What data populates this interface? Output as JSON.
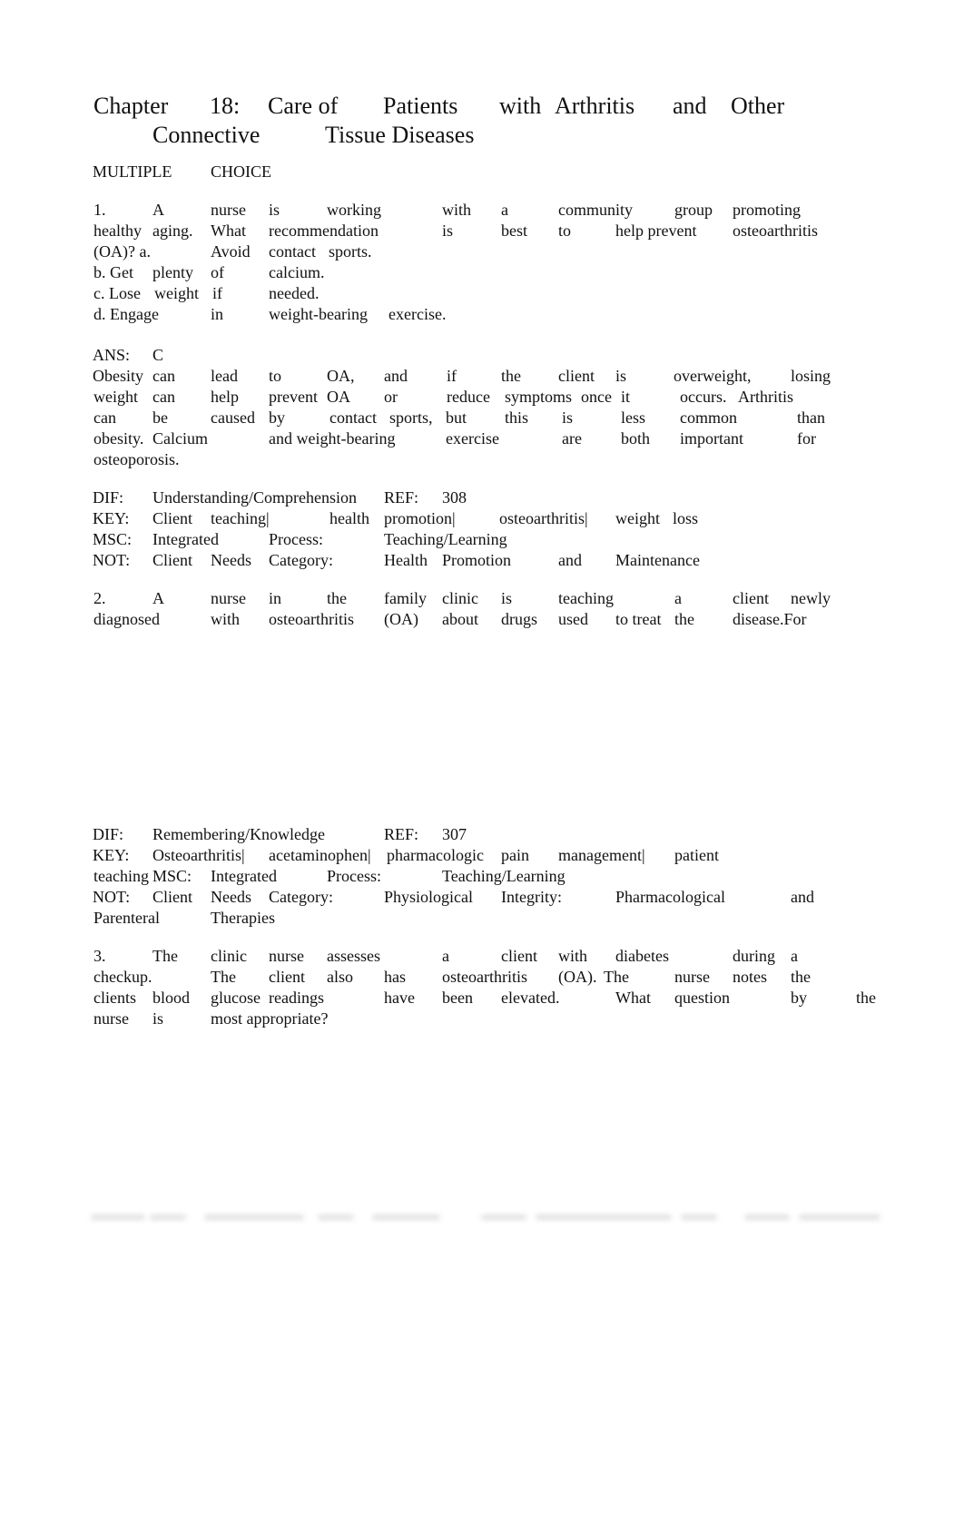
{
  "document": {
    "title_line1": [
      "Chapter",
      "18:",
      "Care of",
      "Patients",
      "with",
      "Arthritis",
      "and",
      "Other"
    ],
    "title_line2": [
      "Connective",
      "Tissue Diseases"
    ],
    "section_heading": [
      "MULTIPLE",
      "CHOICE"
    ],
    "q1": {
      "lines": [
        [
          "1.",
          "A",
          "nurse",
          "is",
          "working",
          "with",
          "a",
          "community",
          "group",
          "promoting"
        ],
        [
          "healthy",
          "aging.",
          "What",
          "recommendation",
          "is",
          "best",
          "to",
          "help prevent",
          "osteoarthritis"
        ],
        [
          "(OA)? a.",
          "Avoid",
          "contact",
          "sports."
        ],
        [
          "b. Get",
          "plenty",
          "of",
          "calcium."
        ],
        [
          "c. Lose",
          "weight",
          "if",
          "needed."
        ],
        [
          "d. Engage",
          "in",
          "weight-bearing",
          "exercise."
        ]
      ],
      "answer": [
        "ANS:",
        "C"
      ],
      "rationale_lines": [
        [
          "Obesity",
          "can",
          "lead",
          "to",
          "OA,",
          "and",
          "if",
          "the",
          "client",
          "is",
          "overweight,",
          "losing"
        ],
        [
          "weight",
          "can",
          "help",
          "prevent",
          "OA",
          "or",
          "reduce",
          "symptoms",
          "once",
          "it",
          "occurs.",
          "Arthritis"
        ],
        [
          "can",
          "be",
          "caused",
          "by",
          "contact",
          "sports,",
          "but",
          "this",
          "is",
          "less",
          "common",
          "than"
        ],
        [
          "obesity.",
          "Calcium",
          "and weight-bearing",
          "exercise",
          "are",
          "both",
          "important",
          "for"
        ],
        [
          "osteoporosis."
        ]
      ],
      "meta": {
        "dif": [
          "DIF:",
          "Understanding/Comprehension",
          "REF:",
          "308"
        ],
        "key": [
          "KEY:",
          "Client",
          "teaching|",
          "health",
          "promotion|",
          "osteoarthritis|",
          "weight",
          "loss"
        ],
        "msc": [
          "MSC:",
          "Integrated",
          "Process:",
          "Teaching/Learning"
        ],
        "not": [
          "NOT:",
          "Client",
          "Needs",
          "Category:",
          "Health",
          "Promotion",
          "and",
          "Maintenance"
        ]
      }
    },
    "q2": {
      "lines": [
        [
          "2.",
          "A",
          "nurse",
          "in",
          "the",
          "family",
          "clinic",
          "is",
          "teaching",
          "a",
          "client",
          "newly"
        ],
        [
          "diagnosed",
          "with",
          "osteoarthritis",
          "(OA)",
          "about",
          "drugs",
          "used",
          "to treat",
          "the",
          "disease.For"
        ]
      ],
      "meta": {
        "dif": [
          "DIF:",
          "Remembering/Knowledge",
          "REF:",
          "307"
        ],
        "key": [
          "KEY:",
          "Osteoarthritis|",
          "acetaminophen|",
          "pharmacologic",
          "pain",
          "management|",
          "patient"
        ],
        "key2": [
          "teaching",
          "MSC:",
          "Integrated",
          "Process:",
          "Teaching/Learning"
        ],
        "not": [
          "NOT:",
          "Client",
          "Needs",
          "Category:",
          "Physiological",
          "Integrity:",
          "Pharmacological",
          "and"
        ],
        "not2": [
          "Parenteral",
          "Therapies"
        ]
      }
    },
    "q3": {
      "lines": [
        [
          "3.",
          "The",
          "clinic",
          "nurse",
          "assesses",
          "a",
          "client",
          "with",
          "diabetes",
          "during",
          "a"
        ],
        [
          "checkup.",
          "The",
          "client",
          "also",
          "has",
          "osteoarthritis",
          "(OA).",
          "The",
          "nurse",
          "notes",
          "the"
        ],
        [
          "clients",
          "blood",
          "glucose",
          "readings",
          "have",
          "been",
          "elevated.",
          "What",
          "question",
          "by",
          "the"
        ],
        [
          "nurse",
          "is",
          "most appropriate?"
        ]
      ]
    }
  }
}
